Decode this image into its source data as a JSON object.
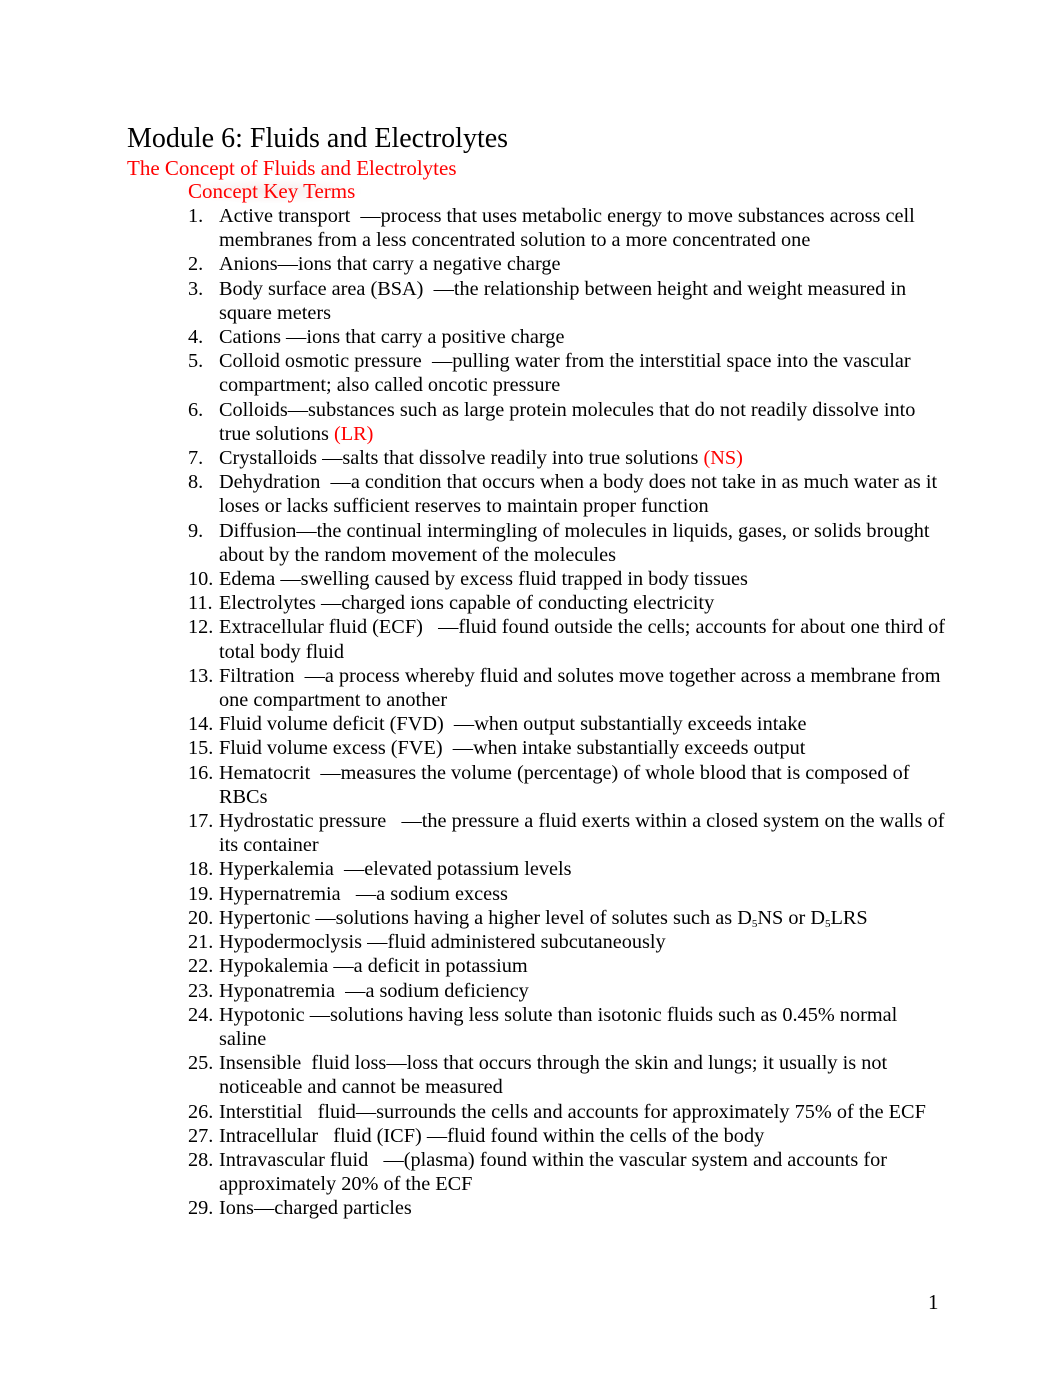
{
  "document": {
    "title": "Module 6: Fluids and Electrolytes",
    "subtitle": "The Concept of Fluids and Electrolytes",
    "section_heading": "Concept Key Terms",
    "page_number": "1",
    "accent_color": "#ff0000"
  },
  "terms": [
    {
      "num": "1.",
      "term": "Active transport",
      "gap": "  ",
      "definition": "—process that uses metabolic energy to move substances across cell membranes from a less concentrated solution to a more concentrated one",
      "note": ""
    },
    {
      "num": "2.",
      "term": "Anions",
      "gap": "",
      "definition": "—ions that carry a negative charge",
      "note": ""
    },
    {
      "num": "3.",
      "term": "Body surface area (BSA)",
      "gap": "  ",
      "definition": "—the relationship between height and weight measured in square meters",
      "note": ""
    },
    {
      "num": "4.",
      "term": "Cations",
      "gap": " ",
      "definition": "—ions that carry a positive charge",
      "note": ""
    },
    {
      "num": "5.",
      "term": "Colloid osmotic pressure",
      "gap": "  ",
      "definition": "—pulling water from the interstitial space into the vascular compartment; also called oncotic pressure",
      "note": ""
    },
    {
      "num": "6.",
      "term": "Colloids",
      "gap": "",
      "definition": "—substances such as large protein molecules that do not readily dissolve into true solutions ",
      "note": "(LR)"
    },
    {
      "num": "7.",
      "term": "Crystalloids",
      "gap": " ",
      "definition": "—salts that dissolve readily into true solutions ",
      "note": "(NS)"
    },
    {
      "num": "8.",
      "term": "Dehydration",
      "gap": "  ",
      "definition": "—a condition that occurs when a body does not take in as much water as it loses or lacks sufficient reserves to maintain proper function",
      "note": ""
    },
    {
      "num": "9.",
      "term": "Diffusion",
      "gap": "",
      "definition": "—the continual intermingling of molecules in liquids, gases, or solids brought about by the random movement of the molecules",
      "note": ""
    },
    {
      "num": "10.",
      "term": "Edema",
      "gap": " ",
      "definition": "—swelling caused by excess fluid trapped in body tissues",
      "note": ""
    },
    {
      "num": "11.",
      "term": "Electrolytes",
      "gap": " ",
      "definition": "—charged ions capable of conducting electricity",
      "note": ""
    },
    {
      "num": "12.",
      "term": "Extracellular fluid (ECF)",
      "gap": "   ",
      "definition": "—fluid found outside the cells; accounts for about one third of total body fluid",
      "note": ""
    },
    {
      "num": "13.",
      "term": "Filtration",
      "gap": "  ",
      "definition": "—a process whereby fluid and solutes move together across a membrane from one compartment to another",
      "note": ""
    },
    {
      "num": "14.",
      "term": "Fluid volume deficit (FVD)",
      "gap": "  ",
      "definition": "—when output substantially exceeds intake",
      "note": ""
    },
    {
      "num": "15.",
      "term": "Fluid volume excess (FVE)",
      "gap": "  ",
      "definition": "—when intake substantially exceeds output",
      "note": ""
    },
    {
      "num": "16.",
      "term": "Hematocrit",
      "gap": "  ",
      "definition": "—measures the volume (percentage) of whole blood that is composed of RBCs",
      "note": ""
    },
    {
      "num": "17.",
      "term": "Hydrostatic pressure",
      "gap": "   ",
      "definition": "—the pressure a fluid exerts within a closed system on the walls of its container",
      "note": ""
    },
    {
      "num": "18.",
      "term": "Hyperkalemia",
      "gap": "  ",
      "definition": "—elevated potassium levels",
      "note": ""
    },
    {
      "num": "19.",
      "term": "Hypernatremia",
      "gap": "   ",
      "definition": "—a sodium excess",
      "note": ""
    },
    {
      "num": "20.",
      "term": "Hypertonic",
      "gap": " ",
      "definition_parts": [
        "—solutions having a higher level of solutes such as D",
        "5",
        "NS or D",
        "5",
        "LRS"
      ],
      "note": ""
    },
    {
      "num": "21.",
      "term": "Hypodermoclysis",
      "gap": " ",
      "definition": "—fluid administered subcutaneously",
      "note": ""
    },
    {
      "num": "22.",
      "term": "Hypokalemia",
      "gap": " ",
      "definition": "—a deficit in potassium",
      "note": ""
    },
    {
      "num": "23.",
      "term": "Hyponatremia",
      "gap": "  ",
      "definition": "—a sodium deficiency",
      "note": ""
    },
    {
      "num": "24.",
      "term": "Hypotonic",
      "gap": " ",
      "definition": "—solutions having less solute than isotonic fluids such as 0.45% normal saline",
      "note": ""
    },
    {
      "num": "25.",
      "term": "Insensible  fluid loss",
      "gap": "",
      "definition": "—loss that occurs through the skin and lungs; it usually is not noticeable and cannot be measured",
      "note": ""
    },
    {
      "num": "26.",
      "term": "Interstitial   fluid",
      "gap": "",
      "definition": "—surrounds the cells and accounts for approximately 75% of the ECF",
      "note": ""
    },
    {
      "num": "27.",
      "term": "Intracellular   fluid (ICF)",
      "gap": " ",
      "definition": "—fluid found within the cells of the body",
      "note": ""
    },
    {
      "num": "28.",
      "term": "Intravascular fluid",
      "gap": "   ",
      "definition": "—(plasma) found within the vascular system and accounts for approximately 20% of the ECF",
      "note": ""
    },
    {
      "num": "29.",
      "term": "Ions",
      "gap": "",
      "definition": "—charged particles",
      "note": ""
    }
  ]
}
